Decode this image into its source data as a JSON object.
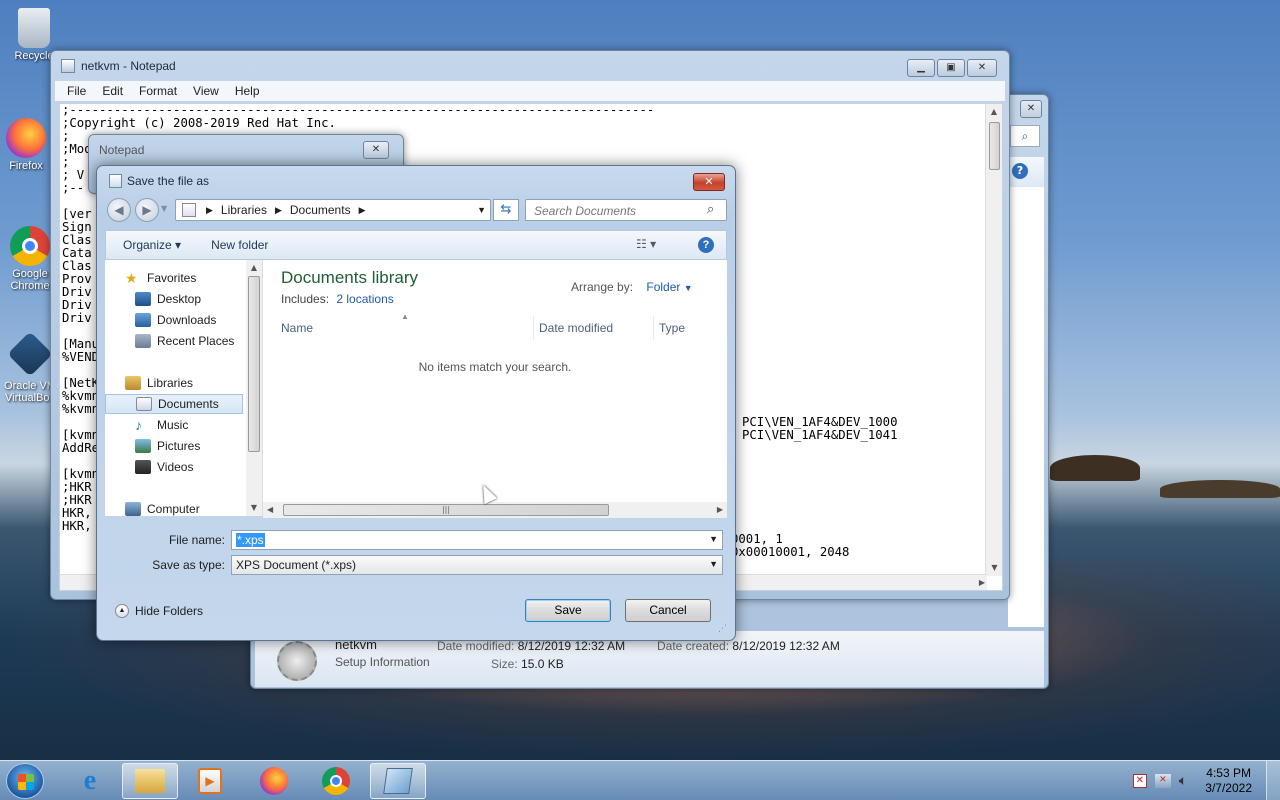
{
  "desktop": {
    "icons": [
      {
        "label": "Recycle",
        "icon": "recycle-bin-icon"
      },
      {
        "label": "Firefox",
        "icon": "firefox-icon"
      },
      {
        "label": "Google Chrome",
        "icon": "chrome-icon"
      },
      {
        "label": "Oracle VM VirtualBox",
        "icon": "virtualbox-icon"
      }
    ]
  },
  "notepad": {
    "title": "netkvm - Notepad",
    "menu": [
      "File",
      "Edit",
      "Format",
      "View",
      "Help"
    ],
    "lines_left": [
      ";-------------------------------------------------------------------------------",
      ";Copyright (c) 2008-2019 Red Hat Inc.",
      ";",
      ";Mod",
      ";",
      "; V",
      ";--",
      "",
      "[ver",
      "Sign",
      "Clas",
      "Cata",
      "Clas",
      "Prov",
      "Driv",
      "Driv",
      "Driv",
      "",
      "[Manu",
      "%VEND",
      "",
      "[NetK",
      "%kvmn",
      "%kvmn",
      "",
      "[kvmn",
      "AddRe",
      "",
      "[kvmn",
      ";HKR",
      ";HKR",
      "HKR,",
      "HKR,"
    ],
    "lines_right": [
      {
        "row": 24,
        "text": "PCI\\VEN_1AF4&DEV_1000"
      },
      {
        "row": 25,
        "text": "PCI\\VEN_1AF4&DEV_1041"
      },
      {
        "row": 33,
        "text": "0001, 1"
      },
      {
        "row": 34,
        "text": "0x00010001, 2048"
      }
    ]
  },
  "notepad_dialog_title": "Notepad",
  "explorer_back": {
    "file_name": "netkvm",
    "file_type": "Setup Information",
    "date_modified_label": "Date modified:",
    "date_modified": "8/12/2019 12:32 AM",
    "date_created_label": "Date created:",
    "date_created": "8/12/2019 12:32 AM",
    "size_label": "Size:",
    "size": "15.0 KB"
  },
  "save_dialog": {
    "title": "Save the file as",
    "close_label": "✕",
    "breadcrumb": [
      "Libraries",
      "Documents"
    ],
    "search_placeholder": "Search Documents",
    "toolbar": {
      "organize": "Organize ▾",
      "new_folder": "New folder"
    },
    "nav": {
      "favorites": "Favorites",
      "desktop": "Desktop",
      "downloads": "Downloads",
      "recent": "Recent Places",
      "libraries": "Libraries",
      "documents": "Documents",
      "music": "Music",
      "pictures": "Pictures",
      "videos": "Videos",
      "computer": "Computer"
    },
    "library_title": "Documents library",
    "includes_label": "Includes:",
    "includes_link": "2 locations",
    "arrange_label": "Arrange by:",
    "arrange_value": "Folder",
    "columns": [
      "Name",
      "Date modified",
      "Type"
    ],
    "empty_message": "No items match your search.",
    "file_name_label": "File name:",
    "file_name_value": "*.xps",
    "save_type_label": "Save as type:",
    "save_type_value": "XPS Document (*.xps)",
    "hide_folders": "Hide Folders",
    "save_button": "Save",
    "cancel_button": "Cancel"
  },
  "taskbar": {
    "time": "4:53 PM",
    "date": "3/7/2022"
  }
}
